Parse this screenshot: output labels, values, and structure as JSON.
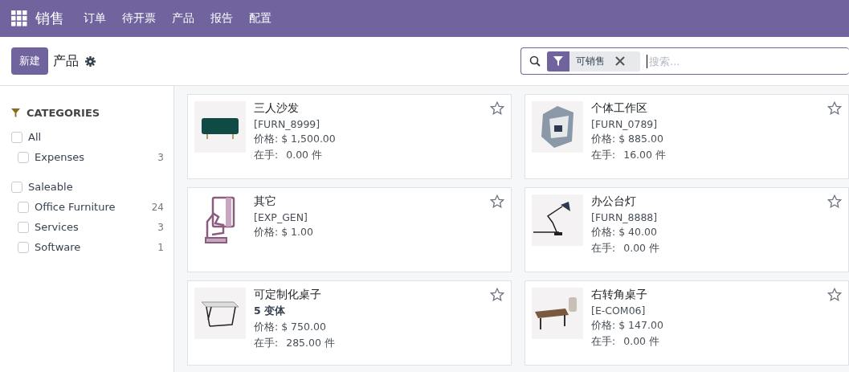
{
  "navbar": {
    "app_name": "销售",
    "menu": [
      "订单",
      "待开票",
      "产品",
      "报告",
      "配置"
    ]
  },
  "control_panel": {
    "new_button": "新建",
    "breadcrumb": "产品",
    "search": {
      "facets": [
        {
          "label": "可销售"
        }
      ],
      "placeholder": "搜索..."
    }
  },
  "sidebar": {
    "title": "CATEGORIES",
    "groups": [
      {
        "label": "All",
        "checked": false,
        "children": [
          {
            "label": "Expenses",
            "count": "3",
            "checked": false
          }
        ]
      },
      {
        "label": "Saleable",
        "checked": false,
        "children": [
          {
            "label": "Office Furniture",
            "count": "24",
            "checked": false
          },
          {
            "label": "Services",
            "count": "3",
            "checked": false
          },
          {
            "label": "Software",
            "count": "1",
            "checked": false
          }
        ]
      }
    ]
  },
  "products": [
    {
      "name": "三人沙发",
      "kind": "sofa",
      "reference": "[FURN_8999]",
      "price": "价格: $ 1,500.00",
      "on_hand_label": "在手:",
      "on_hand": "0.00 件",
      "favorite": false
    },
    {
      "name": "个体工作区",
      "kind": "booth",
      "reference": "[FURN_0789]",
      "price": "价格: $ 885.00",
      "on_hand_label": "在手:",
      "on_hand": "16.00 件",
      "favorite": false
    },
    {
      "name": "其它",
      "kind": "card-hand",
      "reference": "[EXP_GEN]",
      "price": "价格: $ 1.00",
      "favorite": false
    },
    {
      "name": "办公台灯",
      "kind": "lamp",
      "reference": "[FURN_8888]",
      "price": "价格: $ 40.00",
      "on_hand_label": "在手:",
      "on_hand": "0.00 件",
      "favorite": false
    },
    {
      "name": "可定制化桌子",
      "kind": "table",
      "variants": "5 变体",
      "price": "价格: $ 750.00",
      "on_hand_label": "在手:",
      "on_hand": "285.00 件",
      "favorite": false
    },
    {
      "name": "右转角桌子",
      "kind": "desk",
      "reference": "[E-COM06]",
      "price": "价格: $ 147.00",
      "on_hand_label": "在手:",
      "on_hand": "0.00 件",
      "favorite": false
    }
  ]
}
